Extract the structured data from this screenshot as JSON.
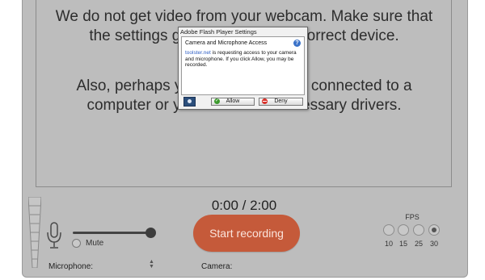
{
  "message": {
    "line1": "We do not get video from your webcam. Make sure that the settings give access to the correct device.",
    "line2": "Also, perhaps your webcam is not connected to a computer or you don't have necessary drivers."
  },
  "flash_dialog": {
    "title": "Adobe Flash Player Settings",
    "heading": "Camera and Microphone Access",
    "site": "toolster.net",
    "body": " is requesting access to your camera and microphone. If you click Allow, you may be recorded.",
    "allow_label": "Allow",
    "deny_label": "Deny",
    "help_glyph": "?"
  },
  "controls": {
    "time": "0:00 / 2:00",
    "record_label": "Start recording",
    "mute_label": "Mute",
    "microphone_label": "Microphone:",
    "camera_label": "Camera:",
    "mic_volume": 0.95
  },
  "fps": {
    "label": "FPS",
    "options": [
      "10",
      "15",
      "25",
      "30"
    ],
    "selected": "30"
  },
  "colors": {
    "record_button": "#c55a3a",
    "background": "#bdbdbd",
    "link": "#2f5fc4"
  }
}
